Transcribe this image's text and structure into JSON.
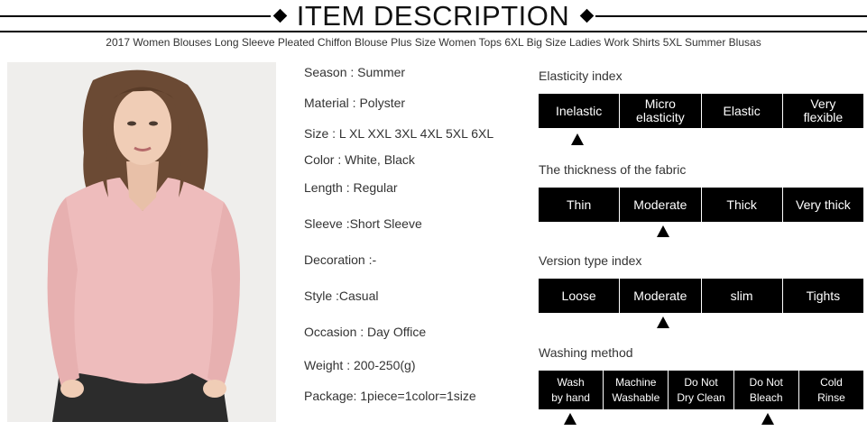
{
  "header": {
    "title": "ITEM DESCRIPTION",
    "subtitle": "2017 Women Blouses Long Sleeve Pleated Chiffon Blouse Plus Size Women Tops 6XL Big Size Ladies Work Shirts 5XL Summer Blusas"
  },
  "specs": [
    "Season : Summer",
    "Material : Polyster",
    "Size : L XL XXL 3XL 4XL 5XL 6XL",
    "Color : White, Black",
    "Length : Regular",
    "Sleeve :Short Sleeve",
    "Decoration :-",
    "Style :Casual",
    "Occasion : Day Office",
    "Weight : 200-250(g)",
    "Package: 1piece=1color=1size"
  ],
  "indices": [
    {
      "title": "Elasticity index",
      "options": [
        [
          "Inelastic"
        ],
        [
          "Micro",
          "elasticity"
        ],
        [
          "Elastic"
        ],
        [
          "Very",
          "flexible"
        ]
      ],
      "selected": [
        0
      ]
    },
    {
      "title": "The thickness of the fabric",
      "options": [
        [
          "Thin"
        ],
        [
          "Moderate"
        ],
        [
          "Thick"
        ],
        [
          "Very thick"
        ]
      ],
      "selected": [
        1
      ]
    },
    {
      "title": "Version type index",
      "options": [
        [
          "Loose"
        ],
        [
          "Moderate"
        ],
        [
          "slim"
        ],
        [
          "Tights"
        ]
      ],
      "selected": [
        1
      ]
    },
    {
      "title": "Washing method",
      "options": [
        [
          "Wash",
          "by hand"
        ],
        [
          "Machine",
          "Washable"
        ],
        [
          "Do Not",
          "Dry Clean"
        ],
        [
          "Do Not",
          "Bleach"
        ],
        [
          "Cold",
          "Rinse"
        ]
      ],
      "selected": [
        0,
        3
      ]
    }
  ],
  "colors": {
    "background": "#ffffff",
    "bar": "#000000",
    "blouse": "#eebcbc",
    "text": "#333333"
  }
}
